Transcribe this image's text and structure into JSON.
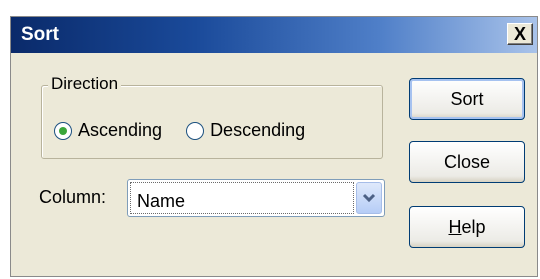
{
  "window": {
    "title": "Sort",
    "close_glyph": "X"
  },
  "direction": {
    "legend": "Direction",
    "options": [
      {
        "label": "Ascending",
        "selected": true
      },
      {
        "label": "Descending",
        "selected": false
      }
    ]
  },
  "column": {
    "label": "Column:",
    "value": "Name"
  },
  "buttons": {
    "sort": "Sort",
    "close": "Close",
    "help_first": "H",
    "help_rest": "elp"
  },
  "colors": {
    "title_bar_start": "#0a2a6a",
    "title_bar_end": "#a9c3ea",
    "dialog_bg": "#ece9d8",
    "radio_dot": "#3aa63a",
    "button_border": "#003c74"
  },
  "icons": {
    "close": "close-icon",
    "dropdown": "chevron-down-icon"
  }
}
